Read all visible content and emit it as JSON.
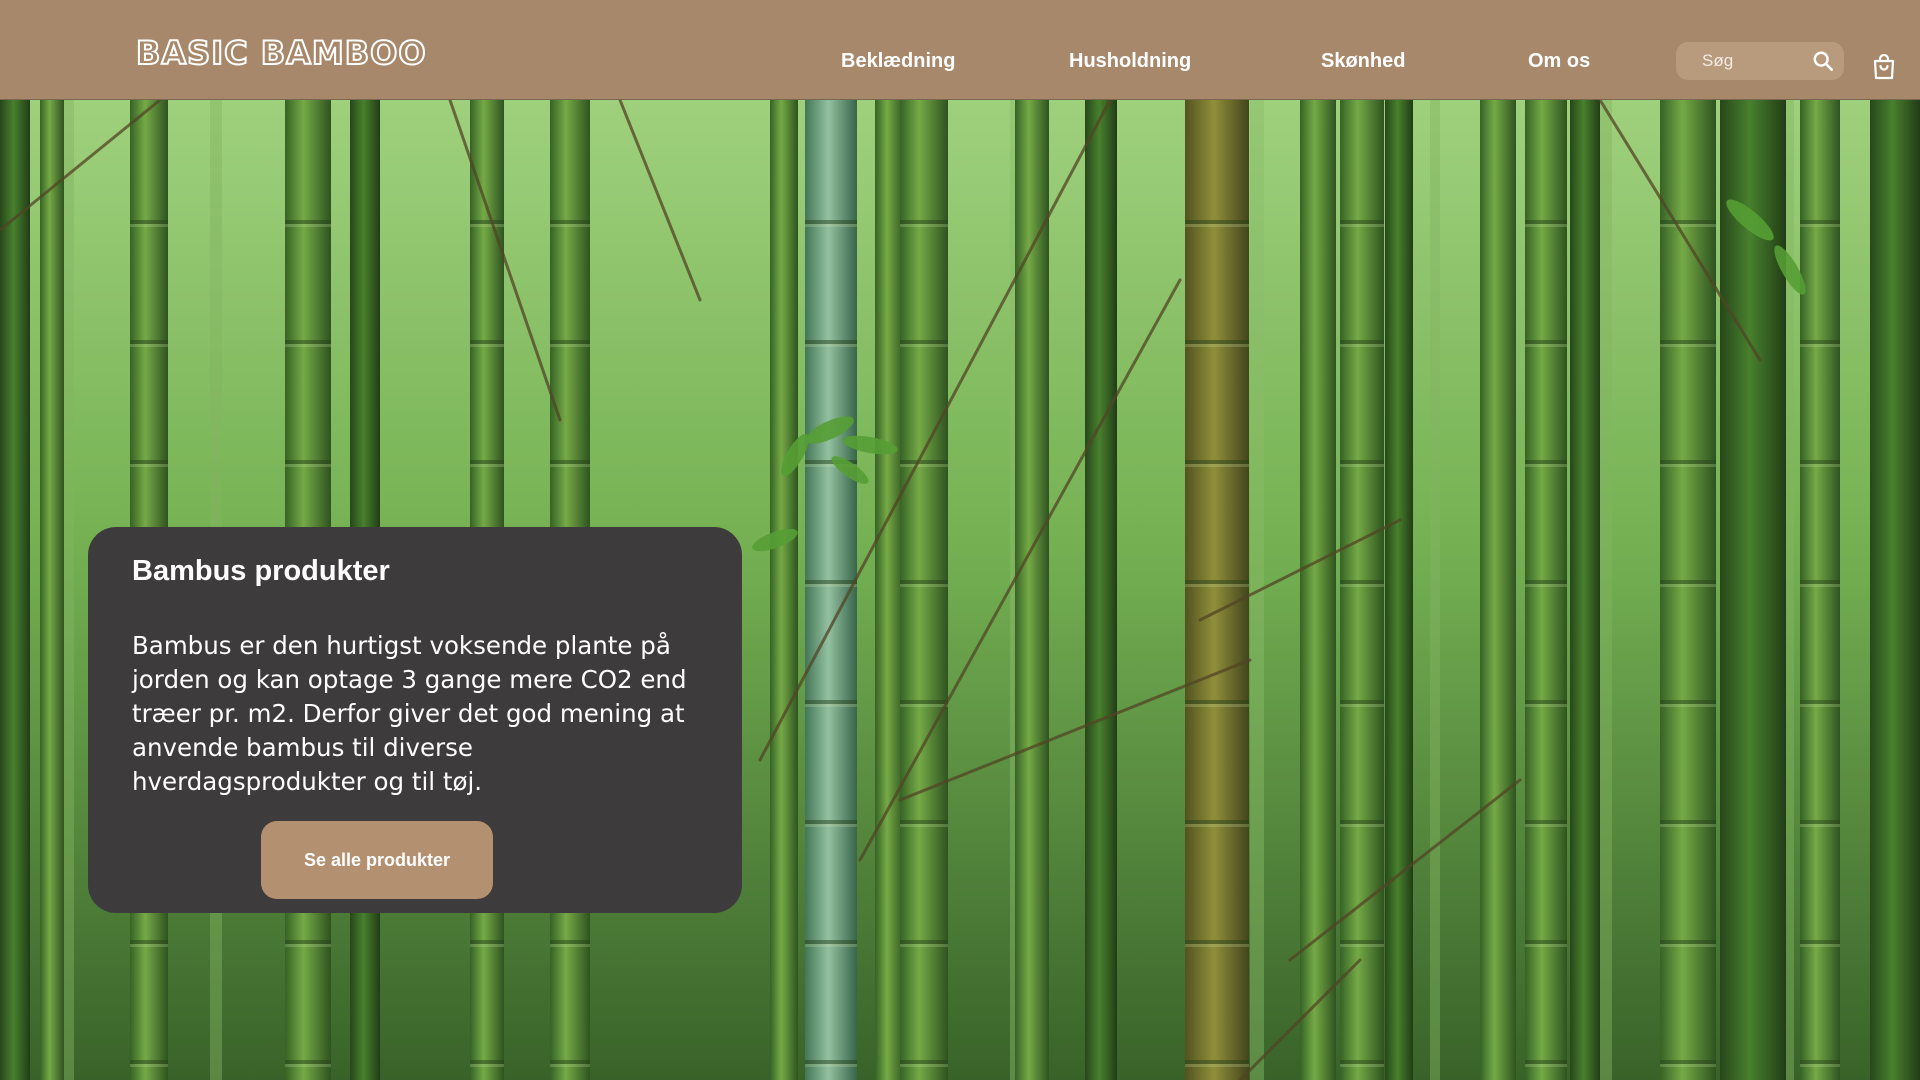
{
  "brand": {
    "logo_text": "BASIC BAMBOO"
  },
  "nav": {
    "items": [
      {
        "label": "Beklædning"
      },
      {
        "label": "Husholdning"
      },
      {
        "label": "Skønhed"
      },
      {
        "label": "Om os"
      }
    ]
  },
  "search": {
    "placeholder": "Søg",
    "value": ""
  },
  "icons": {
    "search": "search-icon",
    "cart": "shopping-bag-icon"
  },
  "hero": {
    "image": "bamboo-forest-photo"
  },
  "card": {
    "title": "Bambus produkter",
    "body": "Bambus er den hurtigst voksende plante på jorden og kan optage 3 gange mere CO2 end træer pr. m2. Derfor giver det god mening at anvende bambus til diverse hverdagsprodukter og til tøj.",
    "button_label": "Se alle produkter"
  },
  "colors": {
    "header_bg": "#a8886a",
    "card_bg": "#3e3b3c",
    "button_bg": "#b39170",
    "text_light": "#ffffff"
  }
}
